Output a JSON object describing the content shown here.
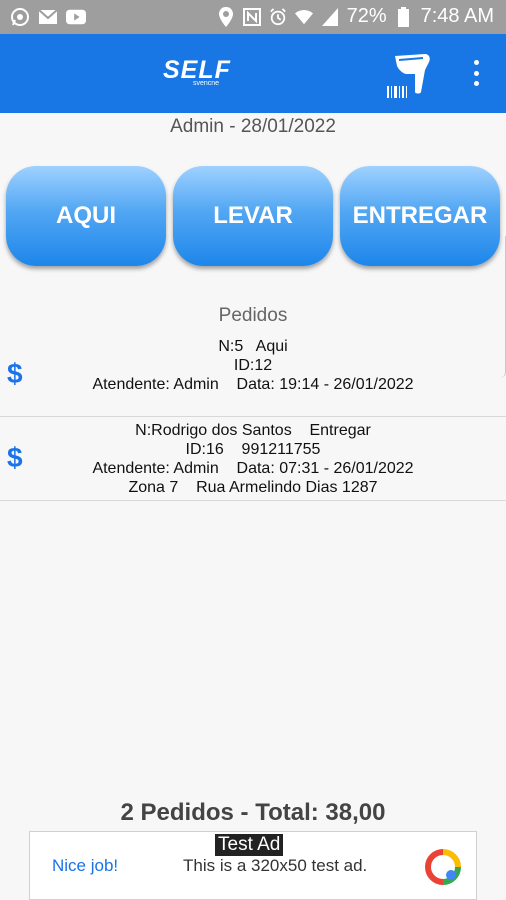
{
  "status_bar": {
    "battery": "72%",
    "time": "7:48 AM",
    "left_icons": [
      "whatsapp-icon",
      "mail-icon",
      "youtube-icon"
    ],
    "right_icons": [
      "location-icon",
      "nfc-icon",
      "alarm-icon",
      "wifi-icon",
      "signal-icon",
      "battery-icon"
    ]
  },
  "appbar": {
    "logo": "SELF",
    "logo_sub": "svencne",
    "actions": [
      "barcode-scanner-icon",
      "more-vert-icon"
    ],
    "color": "#1976e5"
  },
  "header": {
    "subtitle": "Admin - 28/01/2022"
  },
  "buttons": {
    "aqui": "AQUI",
    "levar": "LEVAR",
    "entregar": "ENTREGAR"
  },
  "orders_section": {
    "title": "Pedidos"
  },
  "orders": [
    {
      "icon": "$",
      "line1": "N:5   Aqui",
      "line2": "ID:12",
      "line3": "Atendente: Admin    Data: 19:14 - 26/01/2022",
      "line4": ""
    },
    {
      "icon": "$",
      "line1": "N:Rodrigo dos Santos    Entregar",
      "line2": "ID:16    991211755",
      "line3": "Atendente: Admin    Data: 07:31 - 26/01/2022",
      "line4": "Zona 7    Rua Armelindo Dias 1287"
    }
  ],
  "summary": {
    "total": "2 Pedidos - Total: 38,00"
  },
  "ad": {
    "label": "Test Ad",
    "nice": "Nice job!",
    "text": "This is a 320x50 test ad."
  }
}
